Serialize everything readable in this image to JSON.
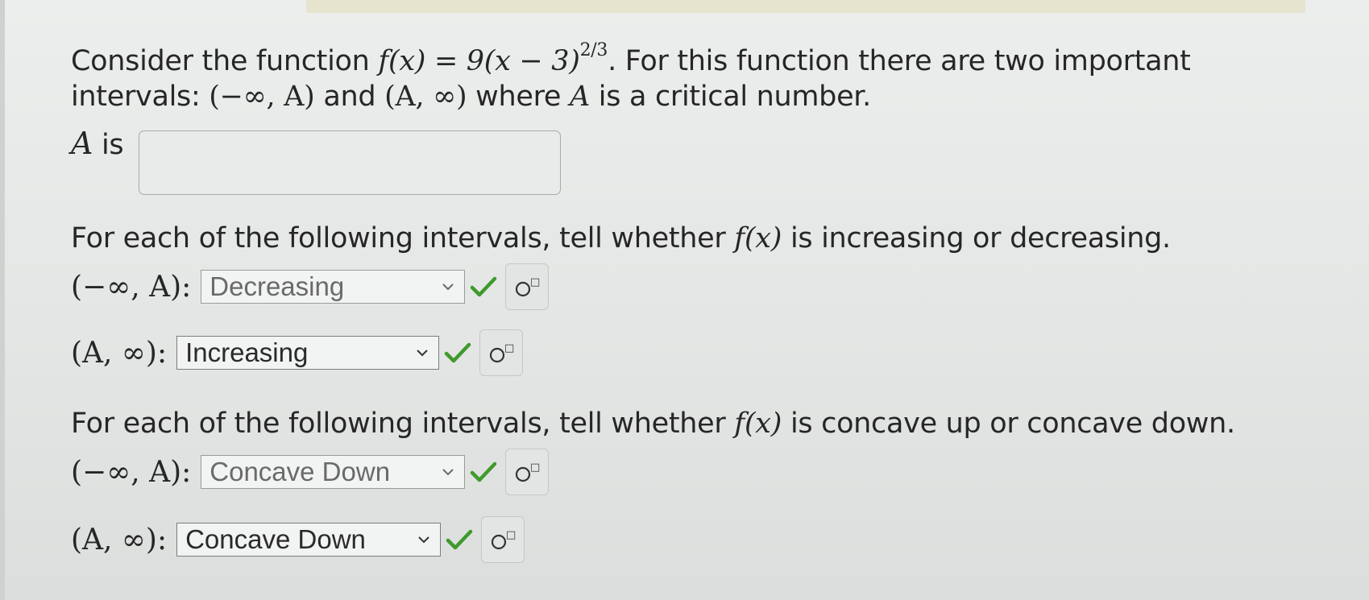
{
  "question": {
    "intro": "Consider the function",
    "func_lhs": "f(x) = 9(x − 3)",
    "func_exp": "2/3",
    "intro_rest": ". For this function there are two important",
    "line2_a": "intervals:",
    "interval1": "(−∞, A)",
    "line2_and": "and",
    "interval2": "(A, ∞)",
    "line2_rest": "where",
    "var_a": "A",
    "line2_end": "is a critical number."
  },
  "critical": {
    "var": "A",
    "label": "is",
    "value": ""
  },
  "increasing_section": {
    "prompt_start": "For each of the following intervals, tell whether",
    "fx": "f(x)",
    "prompt_end": "is increasing or decreasing.",
    "rows": [
      {
        "interval": "(−∞, A):",
        "selected": "Decreasing"
      },
      {
        "interval": "(A, ∞):",
        "selected": "Increasing"
      }
    ]
  },
  "concavity_section": {
    "prompt_start": "For each of the following intervals, tell whether",
    "fx": "f(x)",
    "prompt_end": "is concave up or concave down.",
    "rows": [
      {
        "interval": "(−∞, A):",
        "selected": "Concave Down"
      },
      {
        "interval": "(A, ∞):",
        "selected": "Concave Down"
      }
    ]
  },
  "colors": {
    "check": "#3f9a2c",
    "text": "#262626"
  },
  "icons": {
    "check": "check-icon",
    "chevron": "chevron-down-icon",
    "hint": "formula-hint-icon"
  }
}
